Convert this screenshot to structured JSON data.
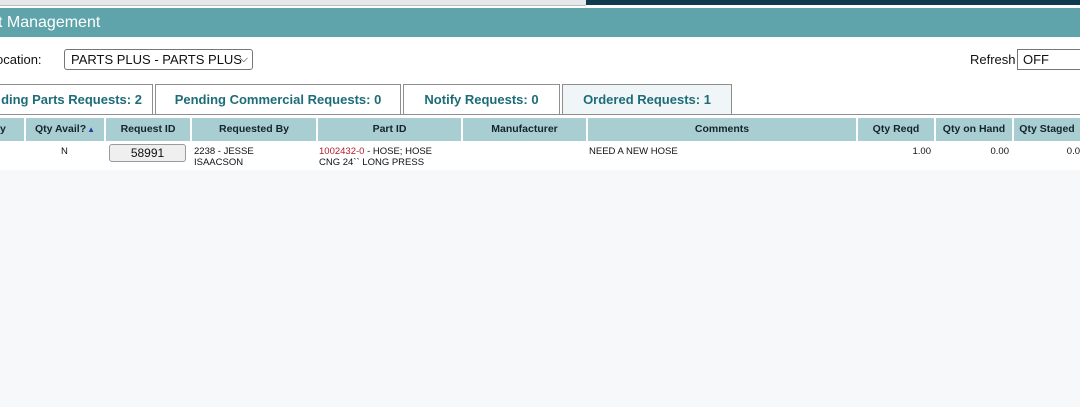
{
  "page_title": "t Management",
  "location": {
    "label": "ocation:",
    "selected": "PARTS PLUS - PARTS PLUS"
  },
  "refresh": {
    "label": "Refresh",
    "value": "OFF"
  },
  "tabs": [
    {
      "label": "ding Parts Requests: 2",
      "active": false
    },
    {
      "label": "Pending Commercial Requests: 0",
      "active": false
    },
    {
      "label": "Notify Requests: 0",
      "active": false
    },
    {
      "label": "Ordered Requests: 1",
      "active": true
    }
  ],
  "columns": [
    "y",
    "Qty Avail?",
    "Request ID",
    "Requested By",
    "Part ID",
    "Manufacturer",
    "Comments",
    "Qty Reqd",
    "Qty on Hand",
    "Qty Staged"
  ],
  "rows": [
    {
      "qty_avail": "N",
      "request_id": "58991",
      "requested_by_line1": "2238 - JESSE",
      "requested_by_line2": "ISAACSON",
      "part_id_link": "1002432-0",
      "part_id_desc1": " - HOSE; HOSE",
      "part_id_desc2": "CNG 24`` LONG PRESS",
      "manufacturer": "",
      "comments": "NEED A NEW HOSE",
      "qty_reqd": "1.00",
      "qty_on_hand": "0.00",
      "qty_staged": "0.0"
    }
  ],
  "colors": {
    "title_bar": "#5fa4aa",
    "header": "#a9ced2",
    "tab_text": "#1d6d78",
    "link": "#b01c2e"
  }
}
